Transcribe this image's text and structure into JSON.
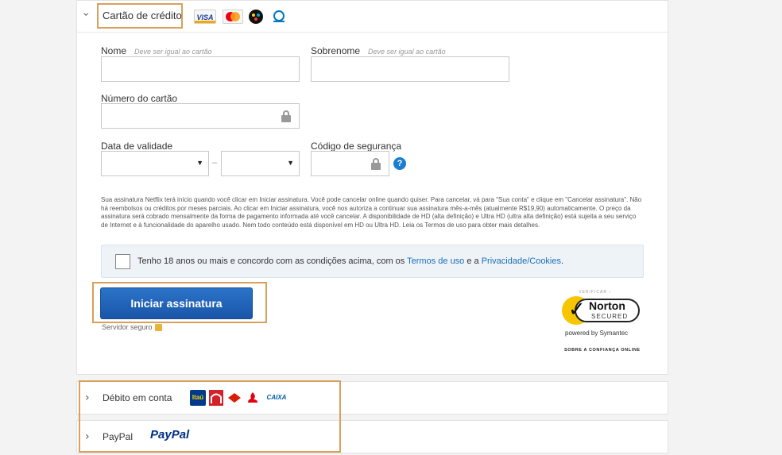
{
  "credit_card": {
    "title": "Cartão de crédito",
    "card_logos": [
      {
        "name": "visa",
        "label": "VISA"
      },
      {
        "name": "mastercard",
        "label": ""
      },
      {
        "name": "elo",
        "label": ""
      },
      {
        "name": "diners",
        "label": ""
      }
    ],
    "first_name": {
      "label": "Nome",
      "hint": "Deve ser igual ao cartão",
      "value": ""
    },
    "last_name": {
      "label": "Sobrenome",
      "hint": "Deve ser igual ao cartão",
      "value": ""
    },
    "card_number": {
      "label": "Número do cartão",
      "value": ""
    },
    "expiry": {
      "label": "Data de validade",
      "month": "",
      "year": "",
      "separator": "–"
    },
    "security_code": {
      "label": "Código de segurança",
      "value": "",
      "help": "?"
    },
    "terms_text": "Sua assinatura Netflix terá início quando você clicar em Iniciar assinatura. Você pode cancelar online quando quiser. Para cancelar, vá para \"Sua conta\" e clique em \"Cancelar assinatura\". Não há reembolsos ou créditos por meses parciais. Ao clicar em Iniciar assinatura, você nos autoriza a continuar sua assinatura mês-a-mês (atualmente R$19,90) automaticamente. O preço da assinatura será cobrado mensalmente da forma de pagamento informada até você cancelar. A disponibilidade de HD (alta definição) e Ultra HD (ultra alta definição) está sujeita a seu serviço de Internet e à funcionalidade do aparelho usado. Nem todo conteúdo está disponível em HD ou Ultra HD. Leia os Termos de uso para obter mais detalhes.",
    "agree": {
      "checked": false,
      "text_before": "Tenho 18 anos ou mais e concordo com as condições acima, com os ",
      "link_terms": "Termos de uso",
      "text_mid": " e a ",
      "link_privacy": "Privacidade/Cookies",
      "text_after": "."
    },
    "submit_label": "Iniciar assinatura",
    "secure_server": "Servidor seguro",
    "norton": {
      "verify": "VERIFICAR ›",
      "name": "Norton",
      "secured": "SECURED",
      "powered": "powered by Symantec",
      "trust": "SOBRE A CONFIANÇA ONLINE"
    }
  },
  "debit": {
    "title": "Débito em conta",
    "banks": [
      {
        "name": "itau",
        "label": "Itaú"
      },
      {
        "name": "bradesco",
        "label": ""
      },
      {
        "name": "hsbc",
        "label": ""
      },
      {
        "name": "santander",
        "label": ""
      },
      {
        "name": "caixa",
        "label": "CAIXA"
      }
    ]
  },
  "paypal": {
    "title": "PayPal",
    "logo_text": "PayPal"
  },
  "colors": {
    "button": "#1a5fb4",
    "link": "#1a6fb5",
    "highlight": "#d9a05b"
  }
}
